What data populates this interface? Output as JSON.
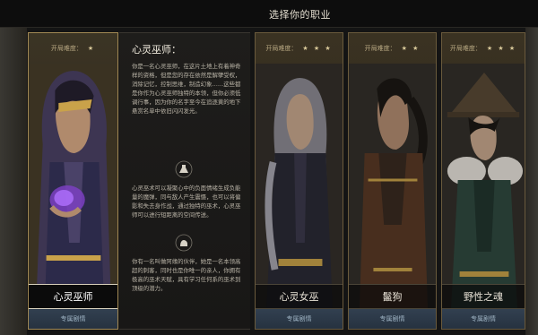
{
  "header": {
    "title": "选择你的职业"
  },
  "difficulty_label": "开局难度：",
  "selected_class": {
    "name": "心灵巫师",
    "stars": "★",
    "story_label": "专属剧情",
    "desc_title": "心灵巫师：",
    "desc_para_1": "你是一名心灵巫师，在这片土地上有着神奇样的资格，但是您的存在依然是解孽受权，消除记忆，控制思维，制造幻象……这些都是你作为心灵巫师独特的本领，但你必须低调行事，因为你的名字至今在追逐黄的地下悬赏名单中依旧闪闪发光。",
    "desc_para_2": "心灵巫术可以凝聚心中的负面情绪生成负能量的魔弹，同与敌人产生震慑，也可以将偏影和失去身作战，通过独特的巫术，心灵巫师可以进行短距离的空间传送。",
    "desc_para_3": "你有一名叫做阿缘的伙伴，她是一名本领高超的刺客，同时也是你唯一的亲人，你拥有极高的巫术天赋，具有学习任何系的巫术到顶级的潜力。"
  },
  "other_classes": [
    {
      "name": "心灵女巫",
      "stars": "★ ★ ★",
      "story_label": "专属剧情"
    },
    {
      "name": "鬣狗",
      "stars": "★ ★",
      "story_label": "专属剧情"
    },
    {
      "name": "野性之魂",
      "stars": "★ ★ ★",
      "story_label": "专属剧情"
    }
  ],
  "colors": {
    "frame_gold": "#a38a55",
    "story_button": "#2f3b4a"
  }
}
